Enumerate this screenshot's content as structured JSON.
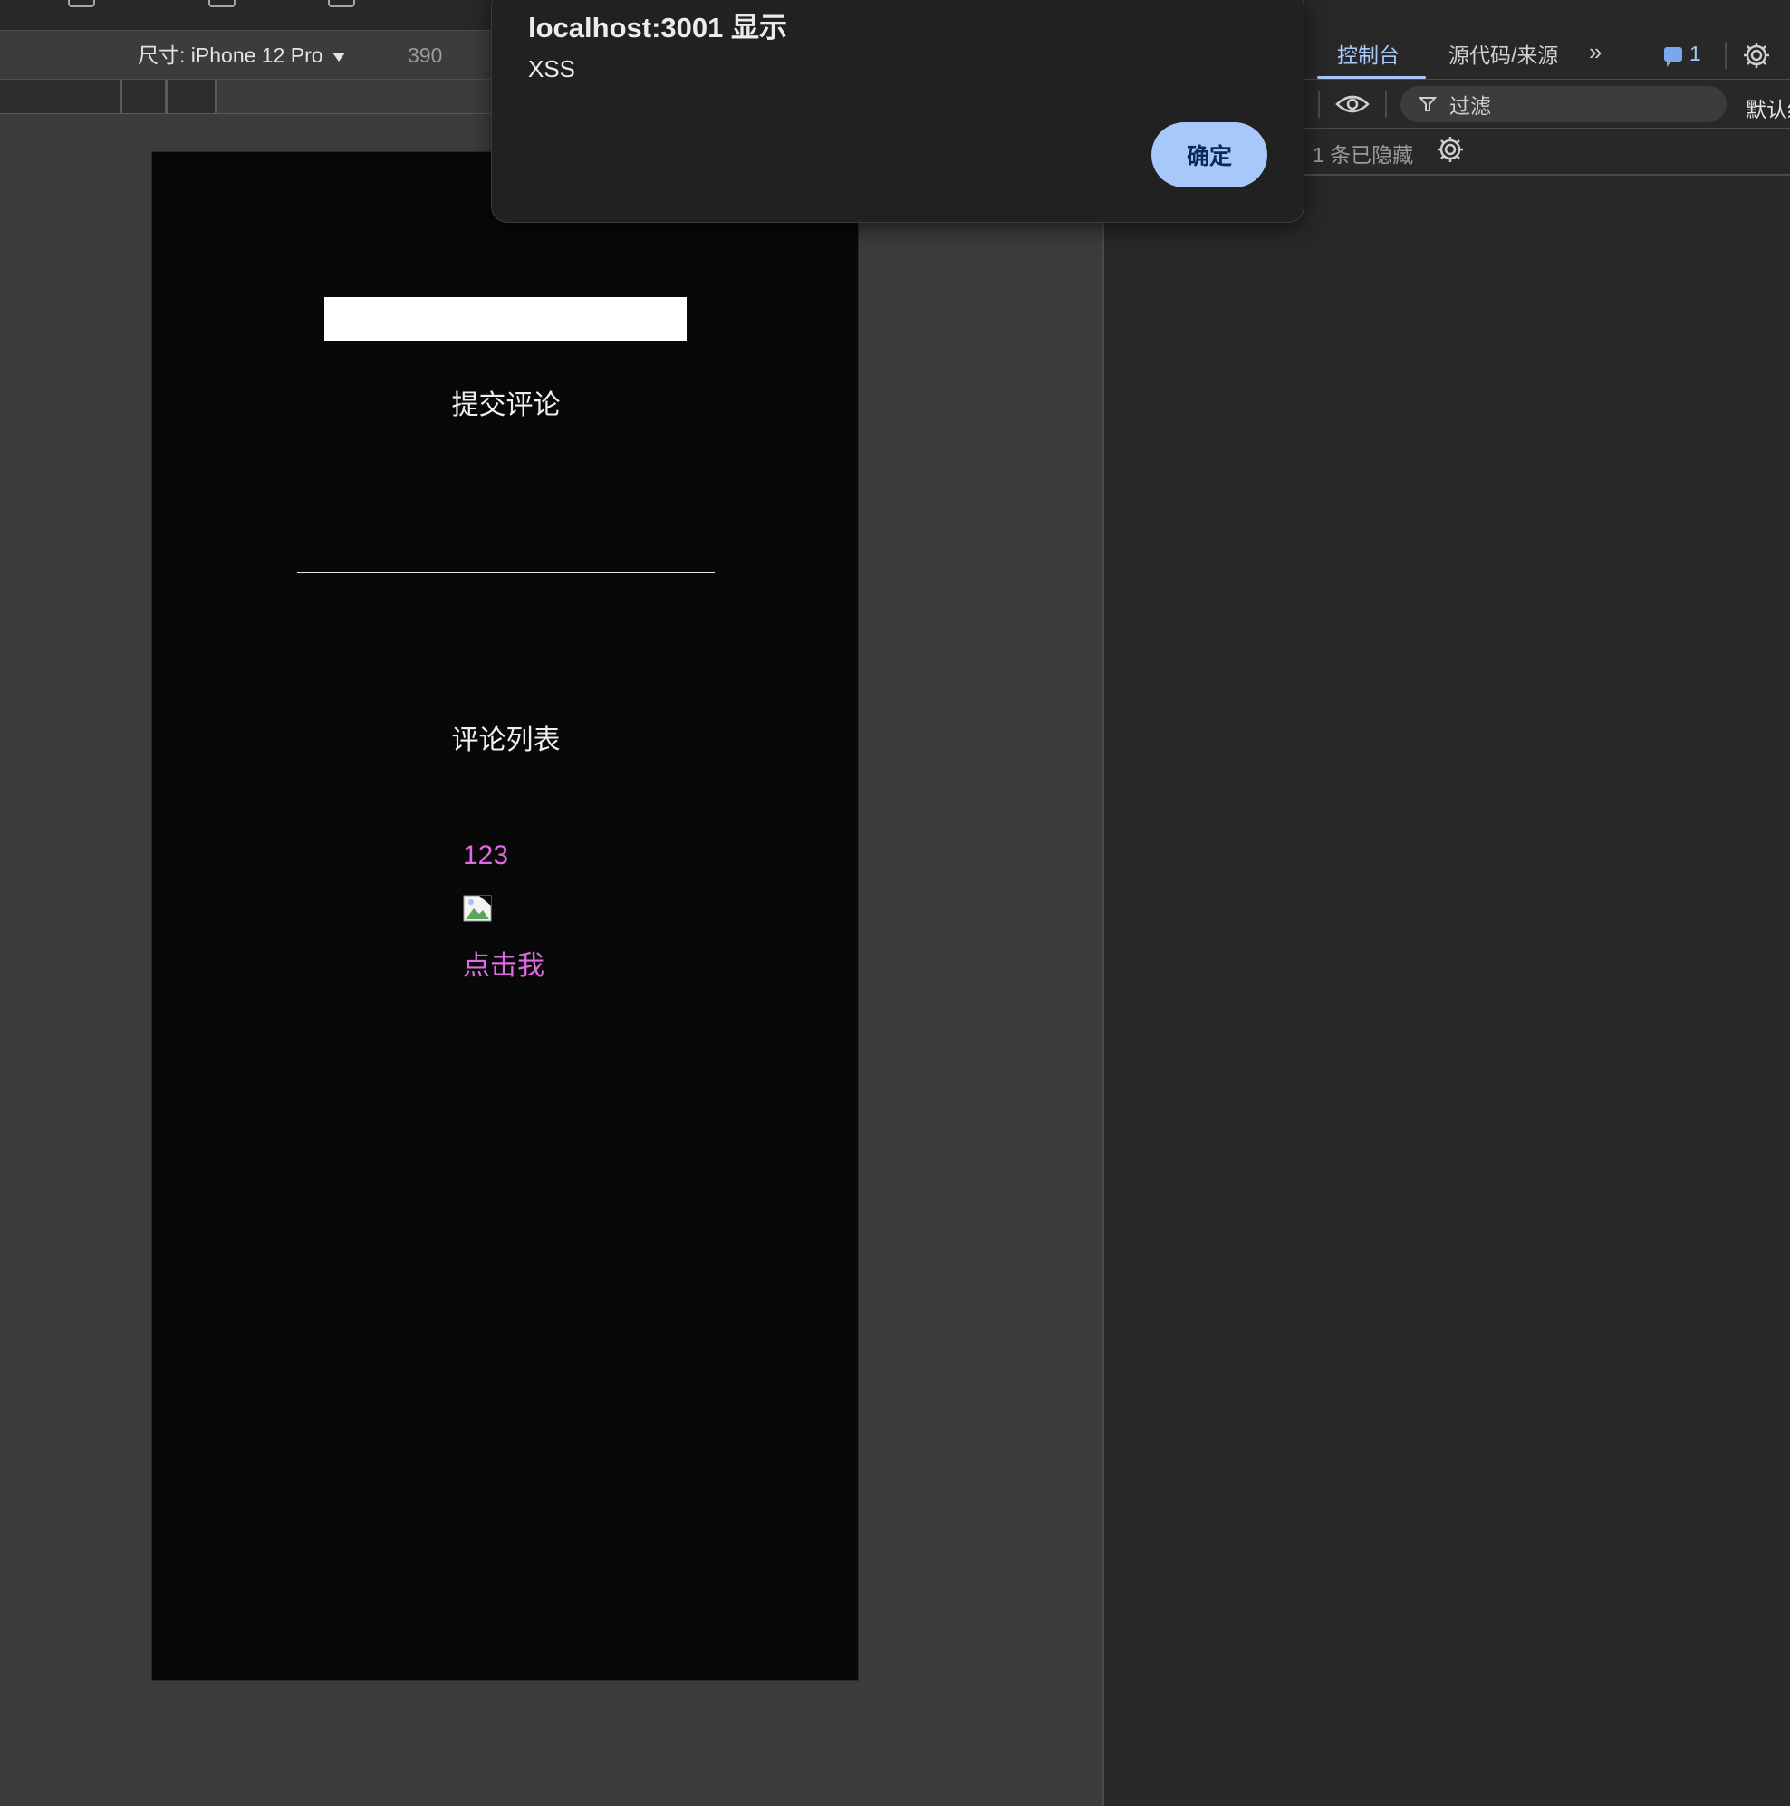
{
  "device_toolbar": {
    "device_label": "尺寸: iPhone 12 Pro",
    "width_value": "390"
  },
  "viewport": {
    "submit_label": "提交评论",
    "list_title": "评论列表",
    "comments": [
      "123"
    ],
    "link_label": "点击我",
    "link_color": "#e06ae6"
  },
  "devtools": {
    "tabs": [
      {
        "label": "控制台",
        "active": true
      },
      {
        "label": "源代码/来源",
        "active": false
      }
    ],
    "more_tabs": "»",
    "issues_count": "1",
    "filter_placeholder": "过滤",
    "levels_label": "默认级别",
    "hidden_messages": "1 条已隐藏",
    "accent_color": "#a8c7fa"
  },
  "alert": {
    "title": "localhost:3001 显示",
    "message": "XSS",
    "ok_label": "确定"
  }
}
